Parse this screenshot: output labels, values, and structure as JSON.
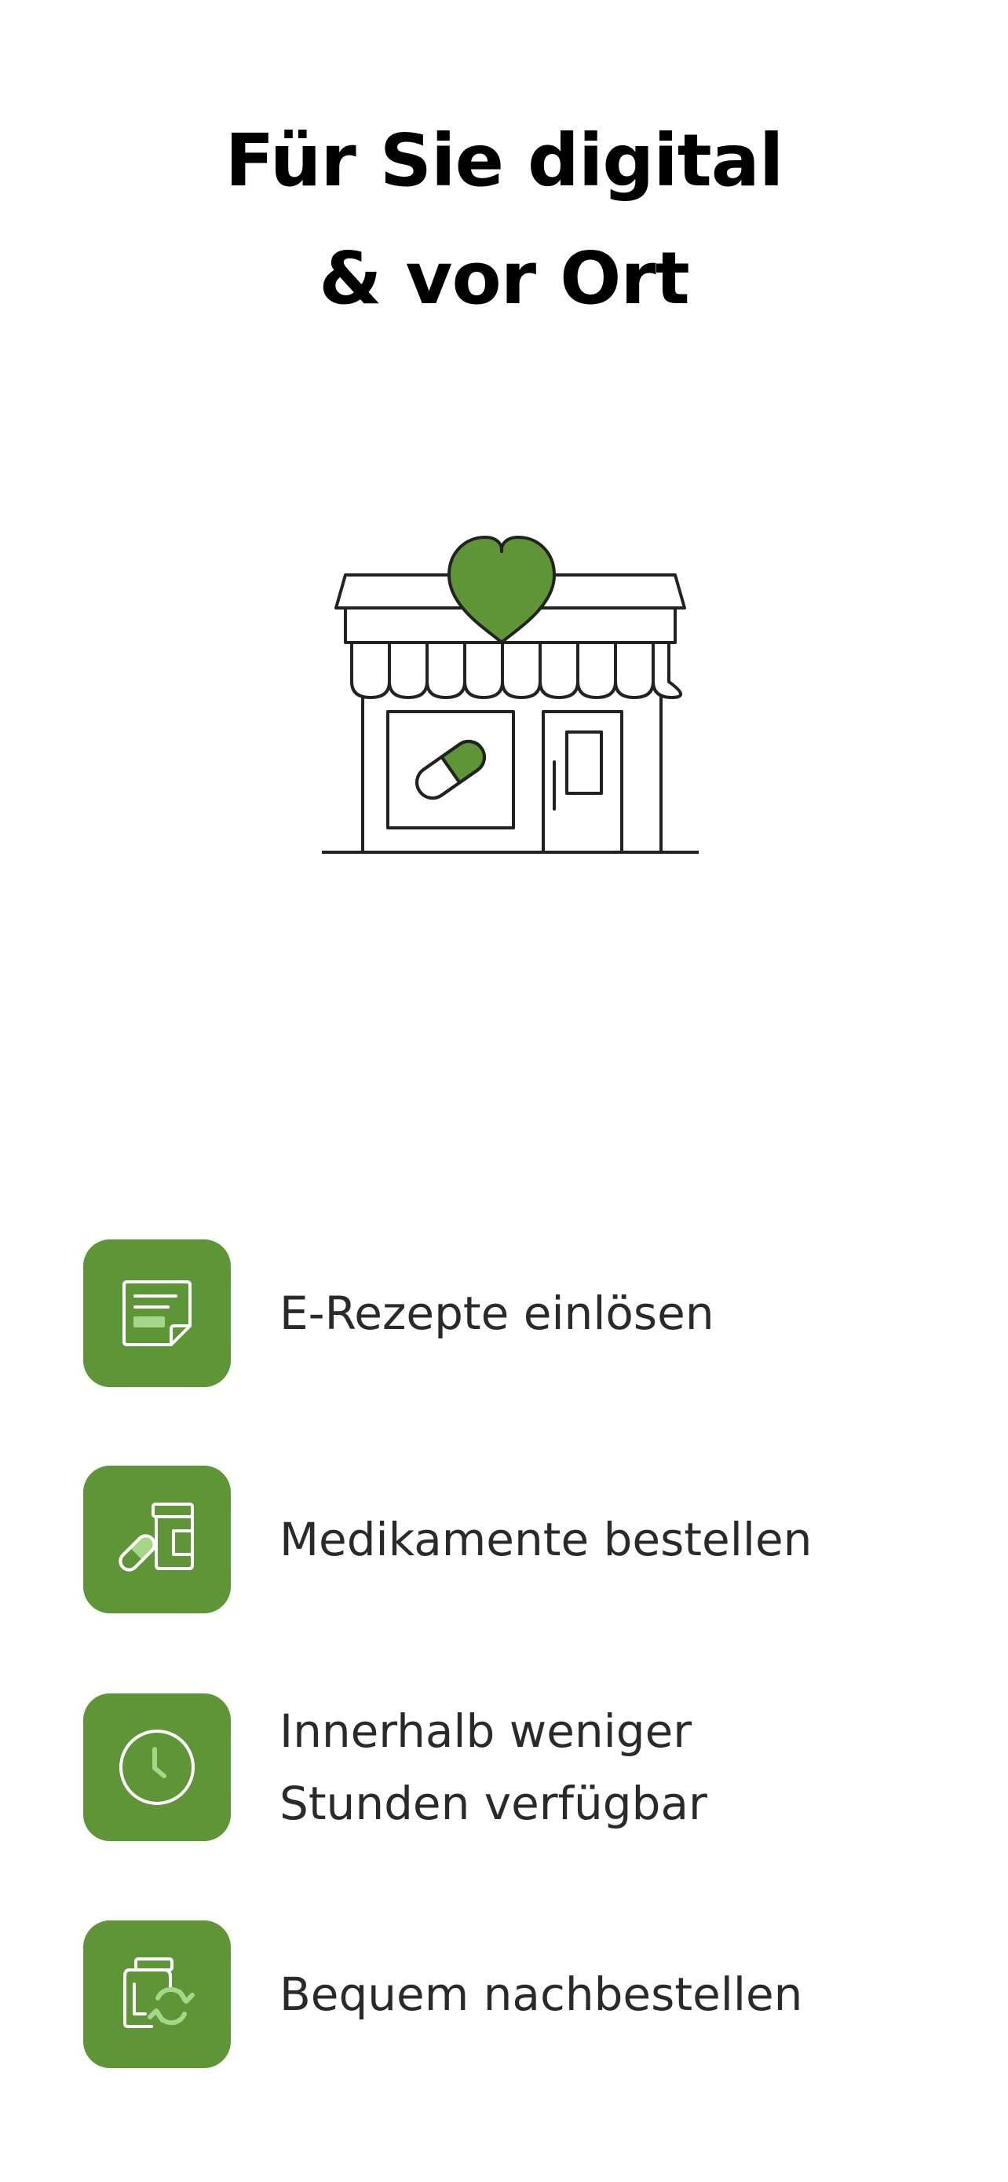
{
  "header": {
    "title_line1": "Für Sie digital",
    "title_line2": "& vor Ort"
  },
  "illustration": {
    "icon": "pharmacy-storefront-heart-icon"
  },
  "features": [
    {
      "icon": "e-prescription-icon",
      "line1": "E-Rezepte einlösen",
      "line2": ""
    },
    {
      "icon": "medication-order-icon",
      "line1": "Medikamente bestellen",
      "line2": ""
    },
    {
      "icon": "clock-icon",
      "line1": "Innerhalb weniger",
      "line2": "Stunden verfügbar"
    },
    {
      "icon": "reorder-icon",
      "line1": "Bequem nachbestellen",
      "line2": ""
    }
  ],
  "colors": {
    "brand_green": "#5E9537",
    "light_green": "#A6D68A",
    "outline": "#222222",
    "text": "#2A2A2A"
  }
}
